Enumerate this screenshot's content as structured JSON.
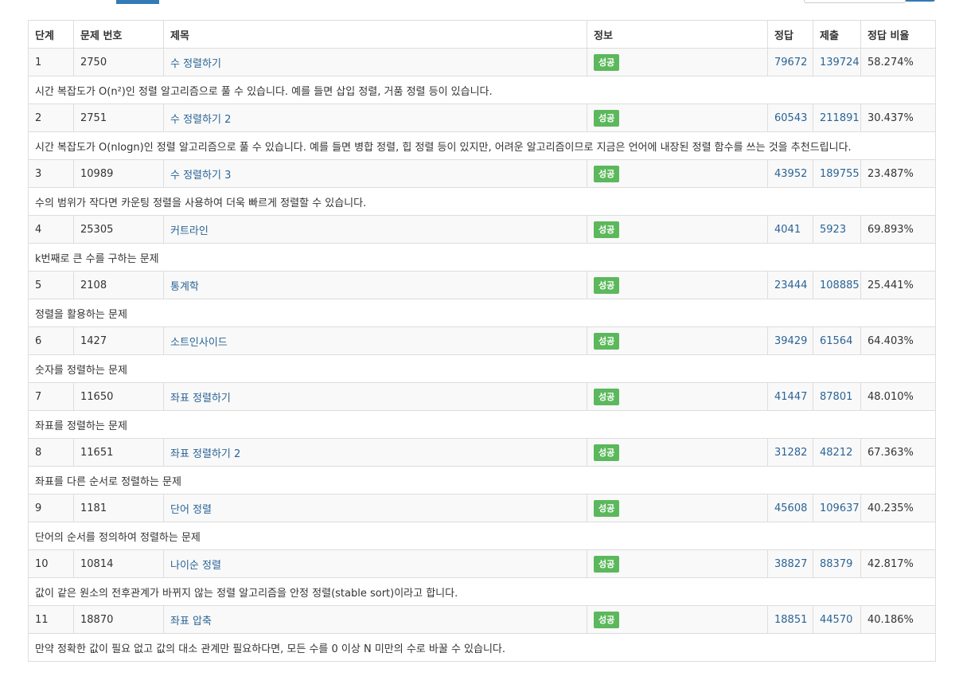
{
  "header": [
    "단계",
    "문제 번호",
    "제목",
    "정보",
    "정답",
    "제출",
    "정답 비율"
  ],
  "colors": {
    "link": "#2a6496",
    "success": "#5cb85c",
    "accent": "#337ab7"
  },
  "rows": [
    {
      "step": "1",
      "id": "2750",
      "title": "수 정렬하기",
      "status": "성공",
      "accepted": "79672",
      "submissions": "139724",
      "ratio": "58.274%",
      "desc": "시간 복잡도가 O(n²)인 정렬 알고리즘으로 풀 수 있습니다. 예를 들면 삽입 정렬, 거품 정렬 등이 있습니다."
    },
    {
      "step": "2",
      "id": "2751",
      "title": "수 정렬하기 2",
      "status": "성공",
      "accepted": "60543",
      "submissions": "211891",
      "ratio": "30.437%",
      "desc": "시간 복잡도가 O(nlogn)인 정렬 알고리즘으로 풀 수 있습니다. 예를 들면 병합 정렬, 힙 정렬 등이 있지만, 어려운 알고리즘이므로 지금은 언어에 내장된 정렬 함수를 쓰는 것을 추천드립니다."
    },
    {
      "step": "3",
      "id": "10989",
      "title": "수 정렬하기 3",
      "status": "성공",
      "accepted": "43952",
      "submissions": "189755",
      "ratio": "23.487%",
      "desc": "수의 범위가 작다면 카운팅 정렬을 사용하여 더욱 빠르게 정렬할 수 있습니다."
    },
    {
      "step": "4",
      "id": "25305",
      "title": "커트라인",
      "status": "성공",
      "accepted": "4041",
      "submissions": "5923",
      "ratio": "69.893%",
      "desc": "k번째로 큰 수를 구하는 문제"
    },
    {
      "step": "5",
      "id": "2108",
      "title": "통계학",
      "status": "성공",
      "accepted": "23444",
      "submissions": "108885",
      "ratio": "25.441%",
      "desc": "정렬을 활용하는 문제"
    },
    {
      "step": "6",
      "id": "1427",
      "title": "소트인사이드",
      "status": "성공",
      "accepted": "39429",
      "submissions": "61564",
      "ratio": "64.403%",
      "desc": "숫자를 정렬하는 문제"
    },
    {
      "step": "7",
      "id": "11650",
      "title": "좌표 정렬하기",
      "status": "성공",
      "accepted": "41447",
      "submissions": "87801",
      "ratio": "48.010%",
      "desc": "좌표를 정렬하는 문제"
    },
    {
      "step": "8",
      "id": "11651",
      "title": "좌표 정렬하기 2",
      "status": "성공",
      "accepted": "31282",
      "submissions": "48212",
      "ratio": "67.363%",
      "desc": "좌표를 다른 순서로 정렬하는 문제"
    },
    {
      "step": "9",
      "id": "1181",
      "title": "단어 정렬",
      "status": "성공",
      "accepted": "45608",
      "submissions": "109637",
      "ratio": "40.235%",
      "desc": "단어의 순서를 정의하여 정렬하는 문제"
    },
    {
      "step": "10",
      "id": "10814",
      "title": "나이순 정렬",
      "status": "성공",
      "accepted": "38827",
      "submissions": "88379",
      "ratio": "42.817%",
      "desc": "값이 같은 원소의 전후관계가 바뀌지 않는 정렬 알고리즘을 안정 정렬(stable sort)이라고 합니다."
    },
    {
      "step": "11",
      "id": "18870",
      "title": "좌표 압축",
      "status": "성공",
      "accepted": "18851",
      "submissions": "44570",
      "ratio": "40.186%",
      "desc": "만약 정확한 값이 필요 없고 값의 대소 관계만 필요하다면, 모든 수를 0 이상 N 미만의 수로 바꿀 수 있습니다."
    }
  ]
}
